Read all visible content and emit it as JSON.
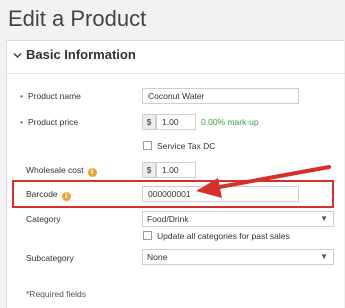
{
  "page_title": "Edit a Product",
  "panel": {
    "title": "Basic Information"
  },
  "fields": {
    "product_name": {
      "label": "Product name",
      "value": "Coconut Water"
    },
    "product_price": {
      "label": "Product price",
      "currency": "$",
      "value": "1.00",
      "markup_text": "0.00% mark-up"
    },
    "service_tax": {
      "label": "Service Tax DC"
    },
    "wholesale_cost": {
      "label": "Wholesale cost",
      "currency": "$",
      "value": "1.00"
    },
    "barcode": {
      "label": "Barcode",
      "value": "000000001"
    },
    "category": {
      "label": "Category",
      "value": "Food/Drink"
    },
    "update_all": {
      "label": "Update all categories for past sales"
    },
    "subcategory": {
      "label": "Subcategory",
      "value": "None"
    }
  },
  "required_note": "*Required fields",
  "colors": {
    "annotation_red": "#d6302a",
    "info_orange": "#f0a22e",
    "markup_green": "#3ba23b"
  }
}
